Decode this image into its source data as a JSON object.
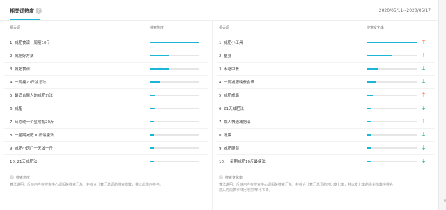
{
  "header": {
    "title": "相关词热度",
    "help_icon": "question-icon",
    "date_range": "2020/05/11~2020/05/17"
  },
  "left": {
    "col_word": "相关词",
    "col_metric": "搜索热度",
    "rows": [
      {
        "label": "1.  减肥食谱一周瘦10斤",
        "level": 1.0
      },
      {
        "label": "2.  减肥好方法",
        "level": 0.4
      },
      {
        "label": "3.  减肥食谱",
        "level": 0.38
      },
      {
        "label": "4.  一周瘦20斤独怎法",
        "level": 0.22
      },
      {
        "label": "5.  最适合懒人的减肥方法",
        "level": 0.12
      },
      {
        "label": "6.  减脂",
        "level": 0.1
      },
      {
        "label": "7.  马恩纯一个星期瘦20斤",
        "level": 0.09
      },
      {
        "label": "8.  一星期减肥10斤最瘦法",
        "level": 0.07
      },
      {
        "label": "9.  减肥小窍门一天减一斤",
        "level": 0.06
      },
      {
        "label": "10. 21天减肥法",
        "level": 0.06
      }
    ],
    "note_title": "搜索热度",
    "note_text": "算法说明：反映用户在搜索中心词相关搜索汇总，并综合计算汇总词的搜索指数，并以此降序排名。"
  },
  "right": {
    "col_word": "相关词",
    "col_metric": "搜索变化率",
    "rows": [
      {
        "label": "1.  减肥小工具",
        "level": 1.0,
        "trend": "up"
      },
      {
        "label": "2.  塑身",
        "level": 0.5,
        "trend": "up"
      },
      {
        "label": "3.  不吃中餐",
        "level": 0.22,
        "trend": "down"
      },
      {
        "label": "4.  一周减肥晚餐食谱",
        "level": 0.18,
        "trend": "down"
      },
      {
        "label": "5.  减肥威面",
        "level": 0.12,
        "trend": "up"
      },
      {
        "label": "6.  21天减肥法",
        "level": 0.08,
        "trend": "down"
      },
      {
        "label": "7.  懒人快速减肥法",
        "level": 0.08,
        "trend": "up"
      },
      {
        "label": "8.  消膜",
        "level": 0.06,
        "trend": "down"
      },
      {
        "label": "9.  减肥腿部",
        "level": 0.06,
        "trend": "down"
      },
      {
        "label": "10. 一星期减肥10斤最瘦法",
        "level": 0.05,
        "trend": "down"
      }
    ],
    "note_title": "搜索变化率",
    "note_text_1": "算法说明：反映用户在搜索中心词相关搜索汇总，并综合计算汇总词的环比变化率，并以变化率的绝对值降序排名，",
    "note_text_2": "箭头方向表示环比增加/环比下降。"
  },
  "colors": {
    "accent": "#1ab6d3",
    "up": "#ff7a45",
    "down": "#1ea96a"
  },
  "corner_text": "0"
}
